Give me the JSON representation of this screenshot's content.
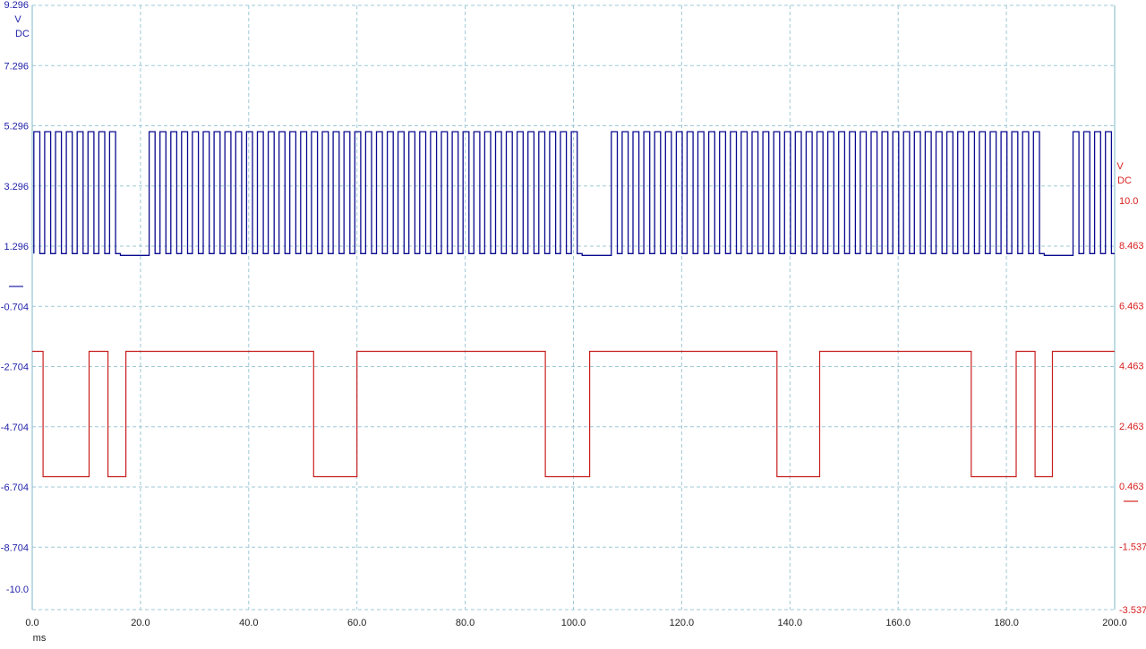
{
  "chart_data": {
    "type": "line",
    "title": "",
    "xaxis": {
      "unit": "ms",
      "range": [
        0,
        200
      ],
      "ticks": [
        "0.0",
        "20.0",
        "40.0",
        "60.0",
        "80.0",
        "100.0",
        "120.0",
        "140.0",
        "160.0",
        "180.0",
        "200.0"
      ]
    },
    "left_axis": {
      "unit": "V",
      "coupling": "DC",
      "color": "#1f1fa8",
      "range": [
        -10.9,
        9.296
      ],
      "tick_labels": [
        "9.296",
        "7.296",
        "5.296",
        "3.296",
        "1.296",
        "-0.704",
        "-2.704",
        "-4.704",
        "-6.704",
        "-8.704",
        "-10.0"
      ],
      "tick_values": [
        9.296,
        7.296,
        5.296,
        3.296,
        1.296,
        -0.704,
        -2.704,
        -4.704,
        -6.704,
        -8.704,
        -10.0
      ]
    },
    "right_axis": {
      "unit": "V",
      "coupling": "DC",
      "color": "#d82020",
      "range": [
        -3.537,
        10.8
      ],
      "tick_labels": [
        "10.0",
        "8.463",
        "6.463",
        "4.463",
        "2.463",
        "0.463",
        "-1.537",
        "-3.537"
      ],
      "tick_values": [
        10.0,
        8.463,
        6.463,
        4.463,
        2.463,
        0.463,
        -1.537,
        -3.537
      ]
    },
    "grid": true,
    "series": [
      {
        "axis": "left",
        "color": "#0a0a90",
        "high": 5.1,
        "low": 1.05,
        "kind": "pulse-train",
        "pulse_groups": [
          {
            "start": 0.3,
            "end": 16.3,
            "period": 2.0
          },
          {
            "start": 21.6,
            "end": 101.6,
            "period": 2.0
          },
          {
            "start": 107.0,
            "end": 187.0,
            "period": 2.0
          },
          {
            "start": 192.3,
            "end": 200.0,
            "period": 2.0
          }
        ],
        "gaps": [
          {
            "start": 16.3,
            "end": 21.6
          },
          {
            "start": 101.6,
            "end": 107.0
          },
          {
            "start": 187.0,
            "end": 192.3
          }
        ]
      },
      {
        "axis": "right",
        "color": "#c81e1e",
        "kind": "step",
        "high": 4.68,
        "low": 0.63,
        "points": [
          [
            0,
            4.68
          ],
          [
            2.0,
            4.68
          ],
          [
            2.0,
            0.63
          ],
          [
            10.5,
            0.63
          ],
          [
            10.5,
            4.68
          ],
          [
            14.0,
            4.68
          ],
          [
            14.0,
            0.63
          ],
          [
            17.3,
            0.63
          ],
          [
            17.3,
            4.68
          ],
          [
            52.0,
            4.68
          ],
          [
            52.0,
            0.63
          ],
          [
            60.0,
            0.63
          ],
          [
            60.0,
            4.68
          ],
          [
            94.8,
            4.68
          ],
          [
            94.8,
            0.63
          ],
          [
            103.0,
            0.63
          ],
          [
            103.0,
            4.68
          ],
          [
            137.6,
            4.68
          ],
          [
            137.6,
            0.63
          ],
          [
            145.5,
            0.63
          ],
          [
            145.5,
            4.68
          ],
          [
            173.5,
            4.68
          ],
          [
            173.5,
            0.63
          ],
          [
            181.8,
            0.63
          ],
          [
            181.8,
            4.68
          ],
          [
            185.3,
            4.68
          ],
          [
            185.3,
            0.63
          ],
          [
            188.5,
            0.63
          ],
          [
            188.5,
            4.68
          ],
          [
            200.0,
            4.68
          ]
        ]
      }
    ]
  }
}
